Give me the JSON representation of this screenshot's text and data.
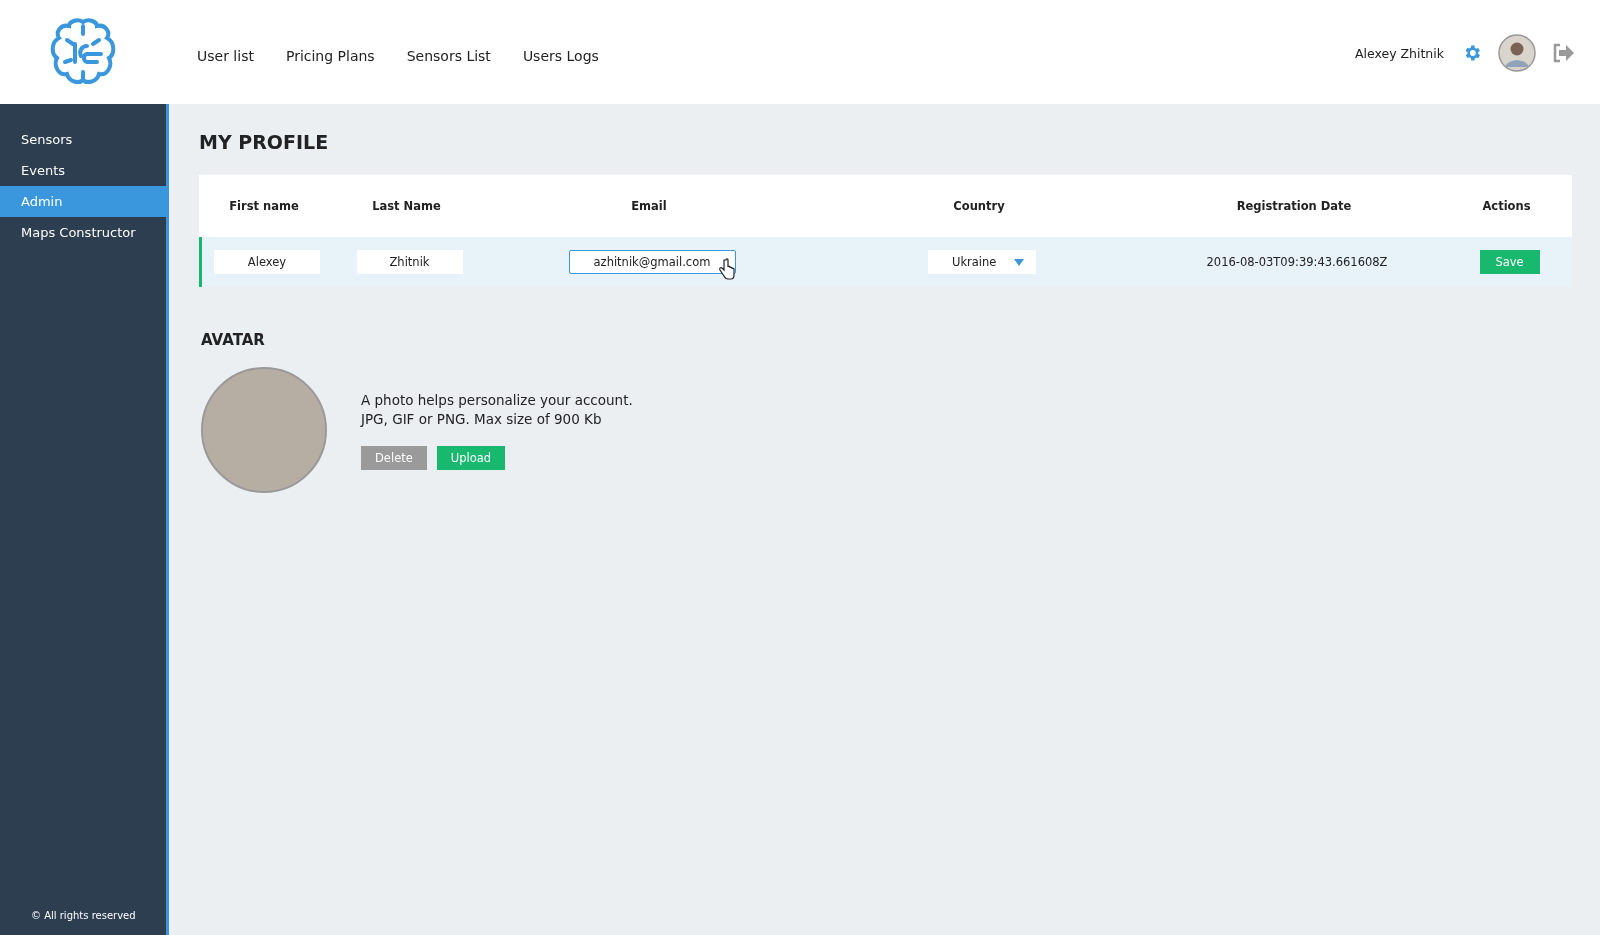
{
  "header": {
    "nav": [
      "User list",
      "Pricing Plans",
      "Sensors List",
      "Users Logs"
    ],
    "user_name": "Alexey Zhitnik"
  },
  "sidebar": {
    "items": [
      {
        "label": "Sensors",
        "selected": false
      },
      {
        "label": "Events",
        "selected": false
      },
      {
        "label": "Admin",
        "selected": true
      },
      {
        "label": "Maps Constructor",
        "selected": false
      }
    ],
    "footer": "© All rights reserved"
  },
  "page_title": "MY PROFILE",
  "table": {
    "columns": [
      "First name",
      "Last Name",
      "Email",
      "Country",
      "Registration Date",
      "Actions"
    ],
    "row": {
      "first_name": "Alexey",
      "last_name": "Zhitnik",
      "email": "azhitnik@gmail.com",
      "country": "Ukraine",
      "registration_date": "2016-08-03T09:39:43.661608Z",
      "action": "Save"
    }
  },
  "avatar": {
    "title": "AVATAR",
    "lines": [
      "A photo helps personalize your account.",
      "JPG, GIF or PNG. Max size of 900 Kb"
    ],
    "buttons": [
      {
        "label": "Delete",
        "kind": "secondary"
      },
      {
        "label": "Upload",
        "kind": "primary"
      }
    ]
  }
}
